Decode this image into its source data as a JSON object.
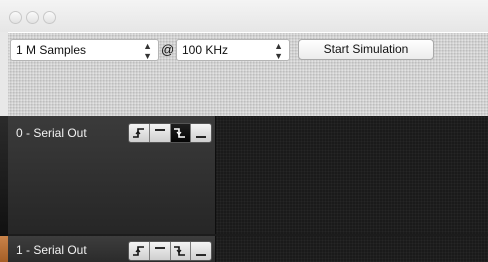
{
  "window": {
    "traffic_lights": [
      "close",
      "minimize",
      "zoom"
    ]
  },
  "toolbar": {
    "samples": {
      "value": "1 M Samples"
    },
    "at_label": "@",
    "rate": {
      "value": "100 KHz"
    },
    "start_button": "Start Simulation"
  },
  "channels": [
    {
      "name": "0 - Serial Out",
      "triggers": [
        {
          "icon": "rising-edge-icon",
          "selected": false
        },
        {
          "icon": "high-level-icon",
          "selected": false
        },
        {
          "icon": "falling-edge-icon",
          "selected": true
        },
        {
          "icon": "low-level-icon",
          "selected": false
        }
      ]
    },
    {
      "name": "1 - Serial Out",
      "accent": "#b86a30",
      "triggers": [
        {
          "icon": "rising-edge-icon",
          "selected": false
        },
        {
          "icon": "high-level-icon",
          "selected": false
        },
        {
          "icon": "falling-edge-icon",
          "selected": false
        },
        {
          "icon": "low-level-icon",
          "selected": false
        }
      ]
    }
  ],
  "colors": {
    "toolbar_bg": "#d2d2d2",
    "channel_bg": "#2a2a2a",
    "accent": "#b86a30"
  }
}
